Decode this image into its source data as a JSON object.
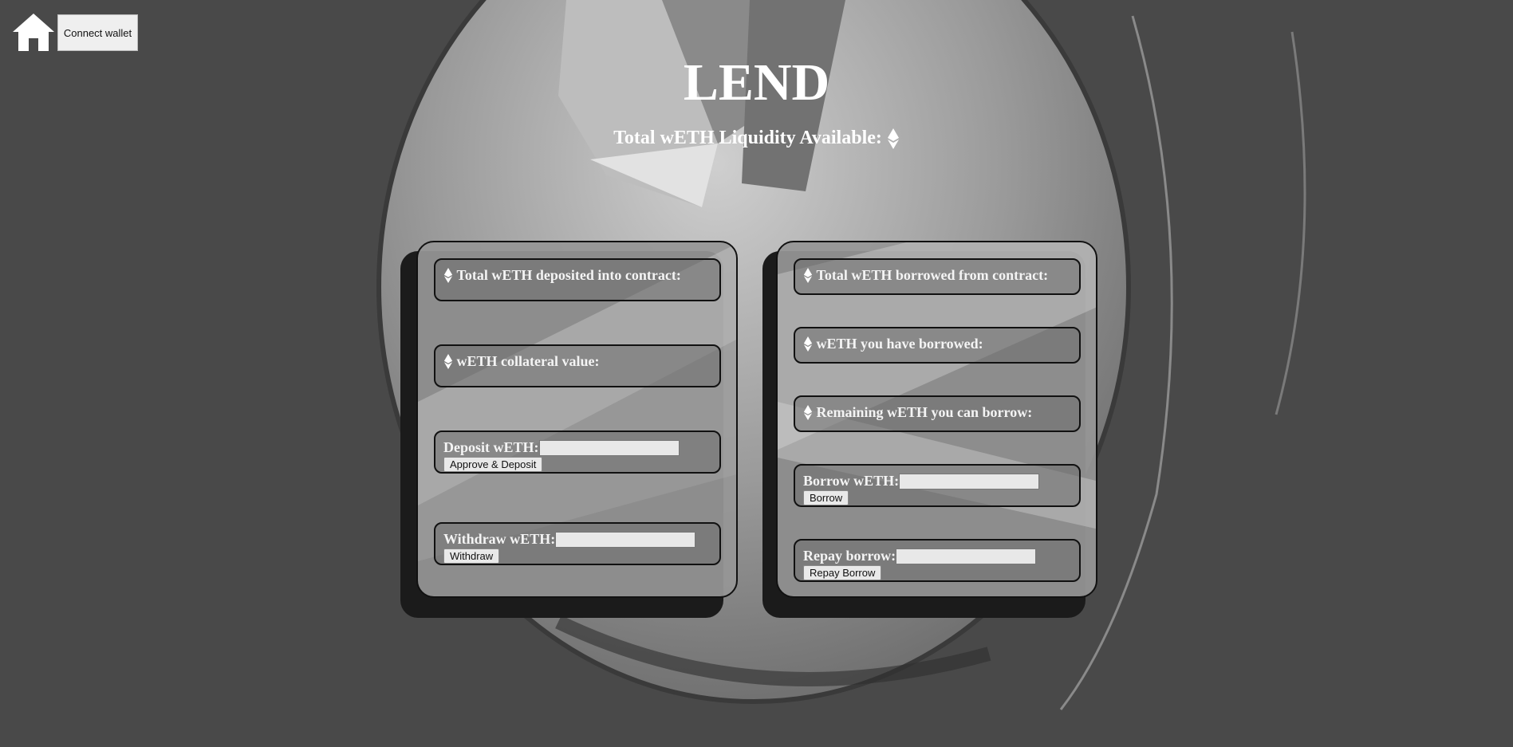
{
  "header": {
    "connect_wallet_label": "Connect wallet",
    "title": "LEND",
    "liquidity_label": "Total wETH Liquidity Available:"
  },
  "lend_panel": {
    "total_deposited_label": "Total wETH deposited into contract:",
    "collateral_label": "wETH collateral value:",
    "deposit_label": "Deposit wETH:",
    "deposit_value": "",
    "deposit_button": "Approve & Deposit",
    "withdraw_label": "Withdraw wETH:",
    "withdraw_value": "",
    "withdraw_button": "Withdraw"
  },
  "borrow_panel": {
    "total_borrowed_label": "Total wETH borrowed from contract:",
    "you_borrowed_label": "wETH you have borrowed:",
    "remaining_label": "Remaining wETH you can borrow:",
    "borrow_label": "Borrow wETH:",
    "borrow_value": "",
    "borrow_button": "Borrow",
    "repay_label": "Repay borrow:",
    "repay_value": "",
    "repay_button": "Repay Borrow"
  },
  "icons": [
    "home-icon",
    "eth-icon"
  ],
  "colors": {
    "background": "#494949",
    "panel": "#969696",
    "text": "#ffffff"
  }
}
